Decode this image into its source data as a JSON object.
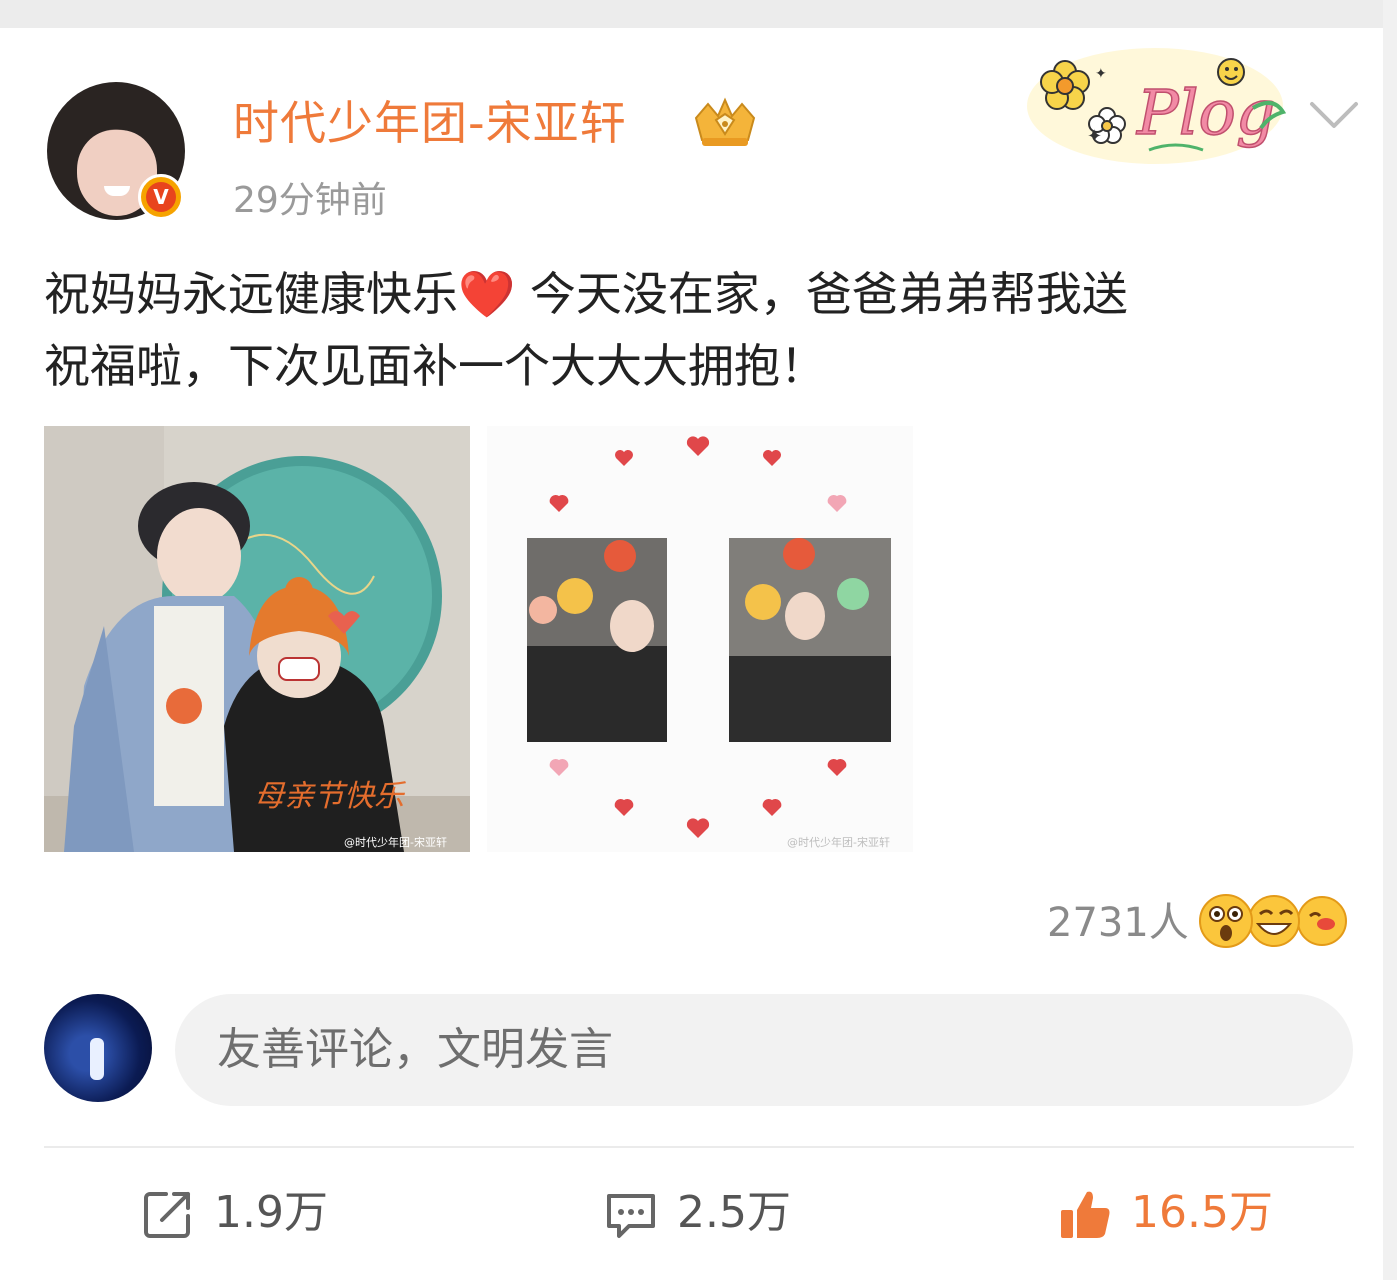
{
  "post": {
    "author": "时代少年团-宋亚轩",
    "verified_badge": "V",
    "time": "29分钟前",
    "content_line1": "祝妈妈永远健康快乐",
    "content_emoji": "❤️",
    "content_line1b": " 今天没在家，爸爸弟弟帮我送",
    "content_line2": "祝福啦，下次见面补一个大大大拥抱！",
    "images": [
      {
        "caption": "母亲节快乐",
        "watermark": "@时代少年团-宋亚轩"
      },
      {
        "watermark": "@时代少年团-宋亚轩"
      }
    ],
    "sticker_text": "Plog",
    "reactions_count": "2731人",
    "reaction_emojis": [
      "surprised-emoji",
      "laugh-emoji",
      "kiss-emoji"
    ]
  },
  "comment": {
    "placeholder": "友善评论，文明发言"
  },
  "actions": {
    "share": "1.9万",
    "comment": "2.5万",
    "like": "16.5万"
  },
  "colors": {
    "accent": "#ef7a3a",
    "heart": "#e5242a",
    "muted": "#9a9a9a"
  }
}
